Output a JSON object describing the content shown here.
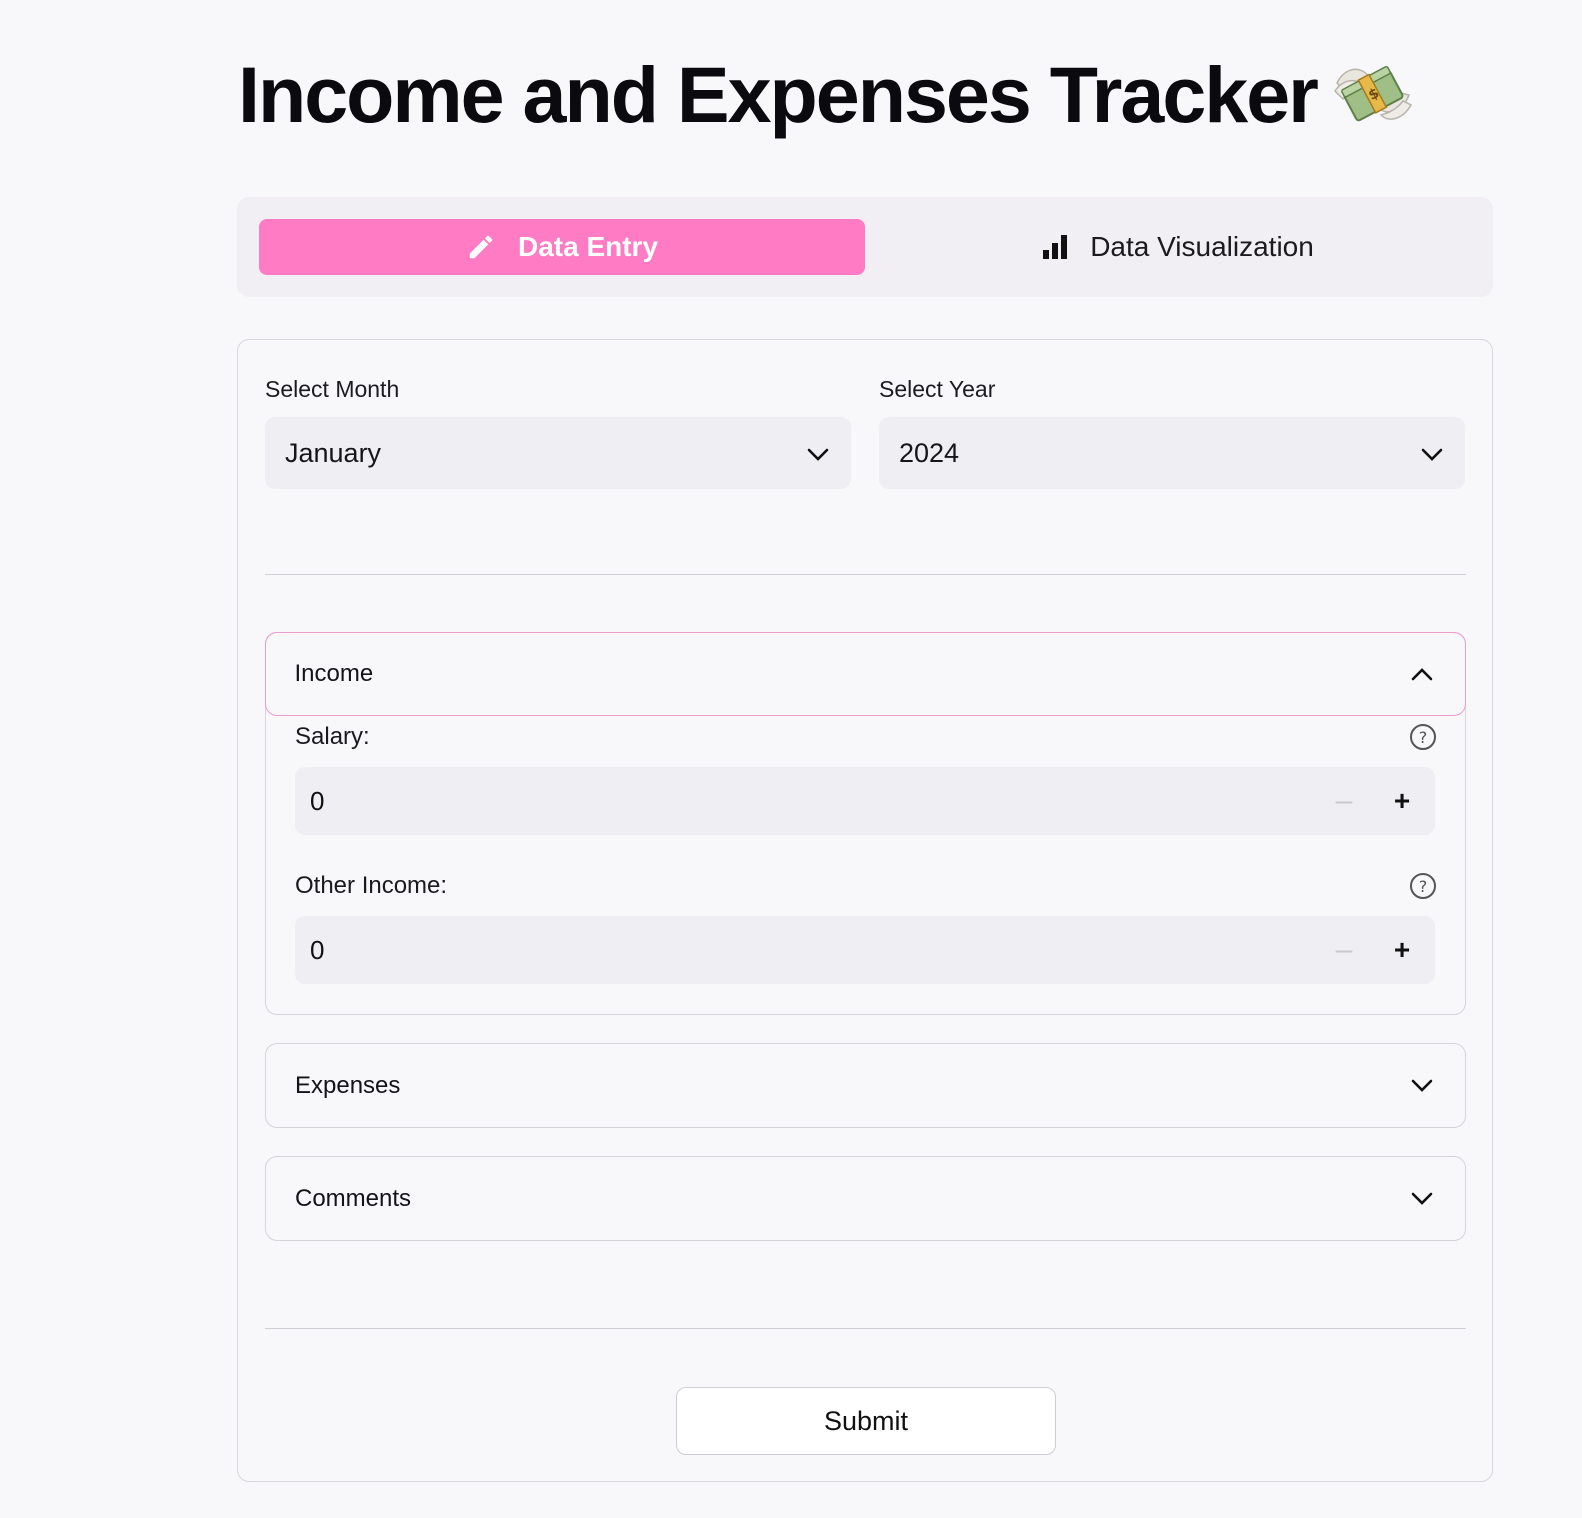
{
  "title": "Income and Expenses Tracker",
  "title_emoji_icon": "money-with-wings-icon",
  "tabs": [
    {
      "label": "Data Entry",
      "icon": "pencil-icon",
      "active": true
    },
    {
      "label": "Data Visualization",
      "icon": "bar-chart-icon",
      "active": false
    }
  ],
  "month": {
    "label": "Select Month",
    "value": "January"
  },
  "year": {
    "label": "Select Year",
    "value": "2024"
  },
  "income": {
    "header": "Income",
    "expanded": true,
    "salary": {
      "label": "Salary:",
      "value": "0"
    },
    "other": {
      "label": "Other Income:",
      "value": "0"
    }
  },
  "expenses": {
    "header": "Expenses",
    "expanded": false
  },
  "comments": {
    "header": "Comments",
    "expanded": false
  },
  "submit_label": "Submit",
  "colors": {
    "accent": "#ff7bc3",
    "accent_border": "#f19ccf",
    "background": "#f8f7fa"
  }
}
